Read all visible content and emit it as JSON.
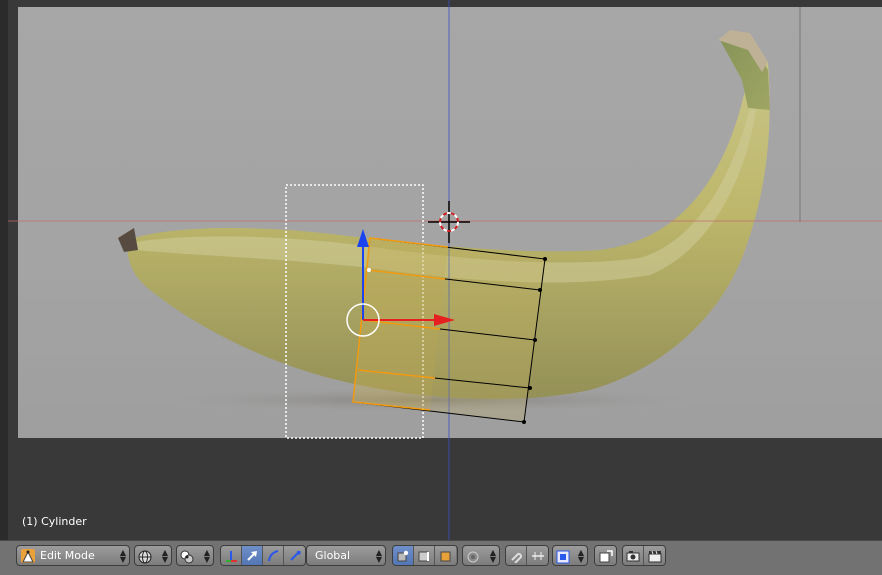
{
  "viewport": {
    "object_label": "(1) Cylinder"
  },
  "header": {
    "mode": {
      "label": "Edit Mode",
      "icon": "edit-mode-icon"
    },
    "viewport_shading": {
      "icon": "sphere-shading-icon"
    },
    "pivot_point": {
      "icon": "pivot-point-icon"
    },
    "manipulator_buttons": [
      {
        "icon": "manipulator-toggle-icon",
        "active": false
      },
      {
        "icon": "translate-arrow-icon",
        "active": true
      },
      {
        "icon": "rotate-arc-icon",
        "active": false
      },
      {
        "icon": "scale-icon",
        "active": false
      }
    ],
    "orientation": {
      "label": "Global"
    },
    "select_mode_buttons": [
      {
        "icon": "vertex-select-icon",
        "active": true
      },
      {
        "icon": "edge-select-icon",
        "active": false
      },
      {
        "icon": "face-select-icon",
        "active": false
      }
    ],
    "proportional_editing": {
      "icon": "proportional-editing-icon"
    },
    "snap_buttons": [
      {
        "icon": "snap-magnet-icon"
      },
      {
        "icon": "snap-increment-icon"
      }
    ],
    "snap_target": {
      "icon": "snap-target-icon"
    },
    "misc_buttons": [
      {
        "icon": "render-icon"
      },
      {
        "icon": "camera-icon"
      },
      {
        "icon": "clapperboard-icon"
      }
    ],
    "colors": {
      "header_bg": "#727272",
      "active_blue": "#5680c2",
      "mesh_select_orange": "#f39c12",
      "axis_x": "#e62020",
      "axis_z": "#1b44f0"
    }
  }
}
